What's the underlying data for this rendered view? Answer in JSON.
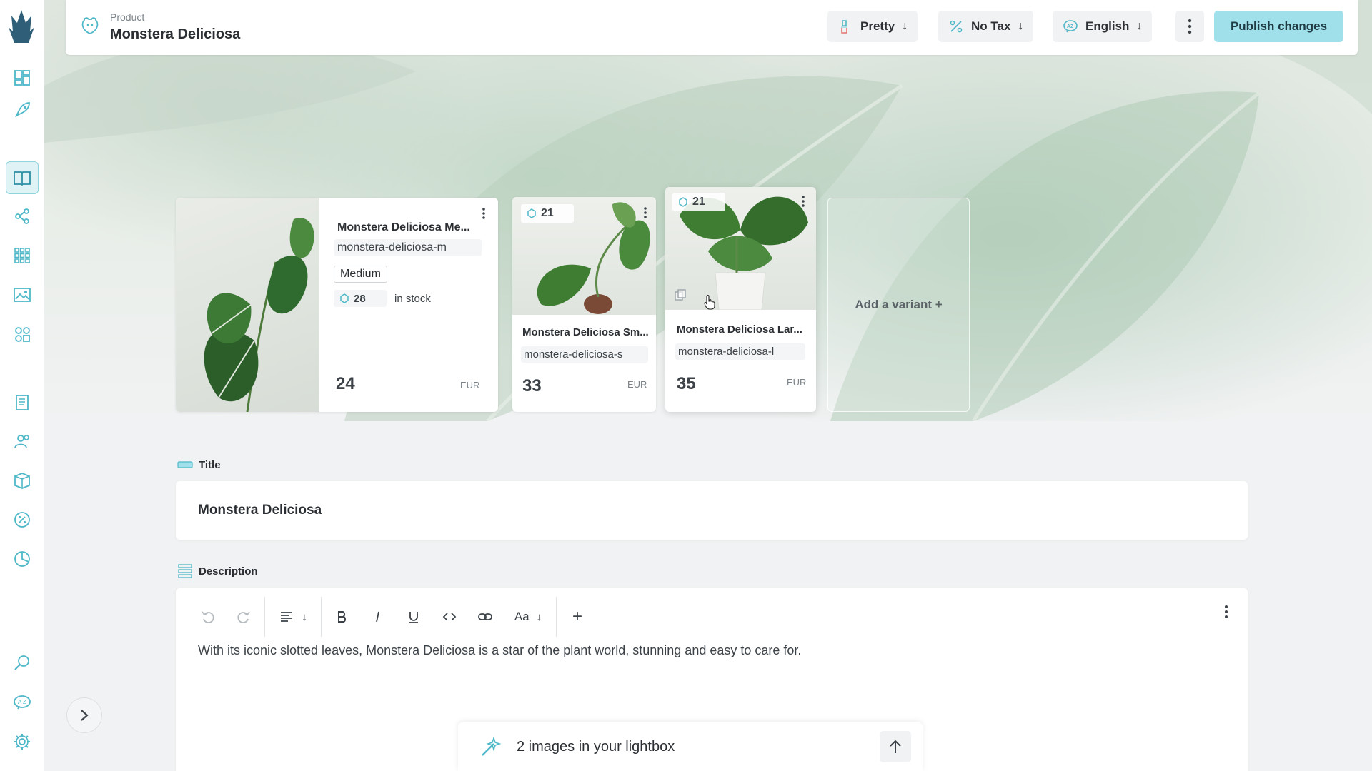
{
  "colors": {
    "accent": "#9fe0ea",
    "accent_icon": "#4fb8c8",
    "sidebar_active_bg": "#dff3f6"
  },
  "sidebar": {
    "items": [
      {
        "name": "dashboard-icon"
      },
      {
        "name": "rocket-icon"
      },
      {
        "name": "book-icon",
        "active": true
      },
      {
        "name": "network-icon"
      },
      {
        "name": "grid-icon"
      },
      {
        "name": "image-icon"
      },
      {
        "name": "shapes-icon"
      },
      {
        "name": "clipboard-icon"
      },
      {
        "name": "users-icon"
      },
      {
        "name": "box-icon"
      },
      {
        "name": "percent-icon"
      },
      {
        "name": "chart-icon"
      },
      {
        "name": "search-icon"
      },
      {
        "name": "translate-icon"
      },
      {
        "name": "gear-icon"
      }
    ]
  },
  "header": {
    "subtitle": "Product",
    "title": "Monstera Deliciosa",
    "format_label": "Pretty",
    "tax_label": "No Tax",
    "language_label": "English",
    "arrow": "↓",
    "publish_label": "Publish changes"
  },
  "variants": [
    {
      "name": "Monstera Deliciosa Me...",
      "sku": "monstera-deliciosa-m",
      "tag": "Medium",
      "stock_count": "28",
      "stock_label": "in stock",
      "price": "24",
      "currency": "EUR"
    },
    {
      "name": "Monstera Deliciosa Sm...",
      "sku": "monstera-deliciosa-s",
      "stock_count": "21",
      "price": "33",
      "currency": "EUR"
    },
    {
      "name": "Monstera Deliciosa Lar...",
      "sku": "monstera-deliciosa-l",
      "stock_count": "21",
      "price": "35",
      "currency": "EUR"
    }
  ],
  "add_variant_label": "Add a variant +",
  "title_field": {
    "label": "Title",
    "value": "Monstera Deliciosa"
  },
  "description_field": {
    "label": "Description",
    "text_style": "Aa",
    "insert": "+",
    "text": "With its iconic slotted leaves, Monstera Deliciosa is a star of the plant world, stunning and easy to care for."
  },
  "lightbox": {
    "label": "2 images in your lightbox"
  }
}
